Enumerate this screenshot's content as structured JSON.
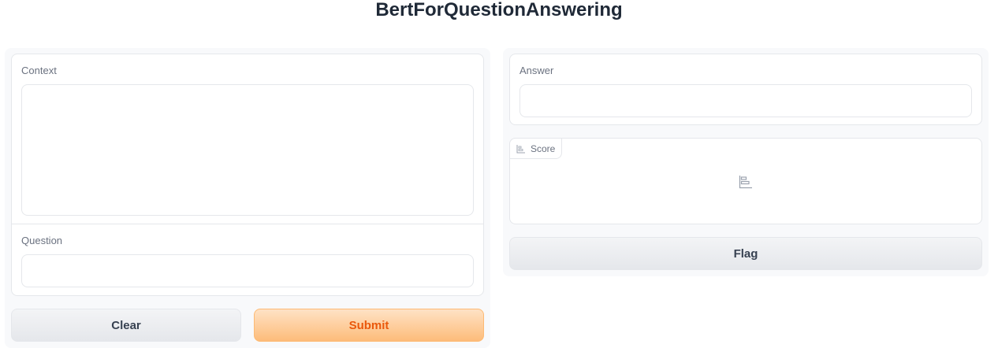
{
  "app": {
    "title": "BertForQuestionAnswering"
  },
  "inputs": {
    "context": {
      "label": "Context",
      "value": ""
    },
    "question": {
      "label": "Question",
      "value": ""
    }
  },
  "outputs": {
    "answer": {
      "label": "Answer",
      "value": ""
    },
    "score": {
      "label": "Score",
      "icon": "bar-chart-icon"
    }
  },
  "buttons": {
    "clear": "Clear",
    "submit": "Submit",
    "flag": "Flag"
  },
  "colors": {
    "accent": "#ea580c",
    "primary_bg_top": "#fee2c5",
    "primary_bg_bottom": "#fdbc7a"
  }
}
